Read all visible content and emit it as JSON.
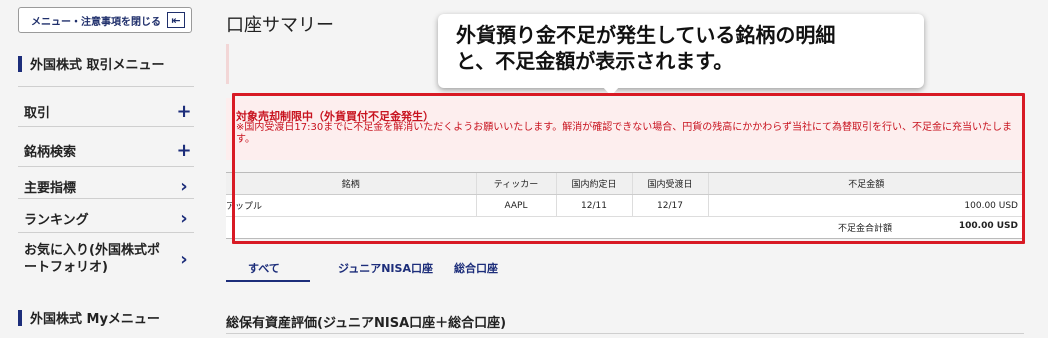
{
  "sidebar": {
    "close_button_label": "メニュー・注意事項を閉じる",
    "close_icon": "collapse-left-icon",
    "section1_title": "外国株式 取引メニュー",
    "items": [
      {
        "label": "取引",
        "indicator": "+"
      },
      {
        "label": "銘柄検索",
        "indicator": "+"
      },
      {
        "label": "主要指標",
        "indicator": "›"
      },
      {
        "label": "ランキング",
        "indicator": "›"
      },
      {
        "label_line1": "お気に入り(外国株式ポ",
        "label_line2": "ートフォリオ)",
        "indicator": "›"
      }
    ],
    "section2_title": "外国株式 Myメニュー"
  },
  "main": {
    "page_title": "口座サマリー",
    "callout": {
      "line1": "外貨預り金不足が発生している銘柄の明細",
      "line2": "と、不足金額が表示されます。"
    },
    "warning": {
      "title": "対象売却制限中（外貨買付不足金発生）",
      "text": "※国内受渡日17:30までに不足金を解消いただくようお願いいたします。解消が確認できない場合、円貨の残高にかかわらず当社にて為替取引を行い、不足金に充当いたします。"
    },
    "table": {
      "headers": [
        "銘柄",
        "ティッカー",
        "国内約定日",
        "国内受渡日",
        "不足金額"
      ],
      "rows": [
        {
          "name": "アップル",
          "ticker": "AAPL",
          "trade_date": "12/11",
          "settle_date": "12/17",
          "amount": "100.00 USD"
        }
      ],
      "total_label": "不足金合計額",
      "total_value": "100.00 USD"
    },
    "tabs": [
      {
        "label": "すべて",
        "active": true
      },
      {
        "label": "ジュニアNISA口座",
        "active": false
      },
      {
        "label": "総合口座",
        "active": false
      }
    ],
    "section_heading": "総保有資産評価(ジュニアNISA口座＋総合口座)"
  },
  "colors": {
    "accent": "#1c2d7a",
    "warning": "#c8131f",
    "highlight_box": "#d81a24"
  }
}
